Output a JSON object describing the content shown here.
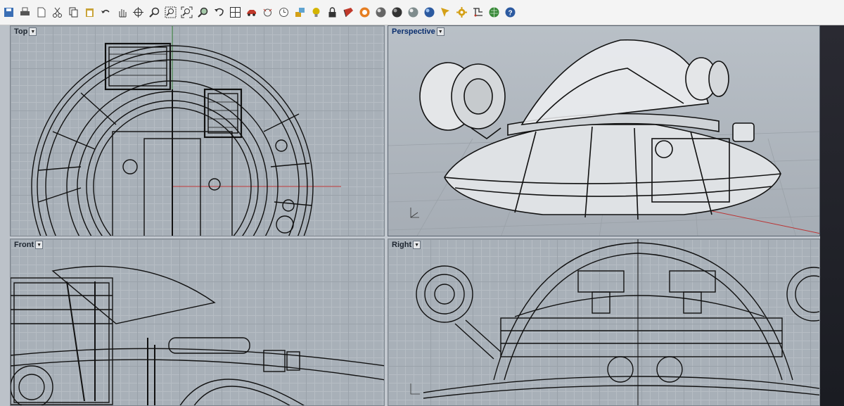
{
  "toolbar": {
    "buttons": [
      {
        "name": "save-file-icon",
        "color": "#3b6fb5"
      },
      {
        "name": "print-icon",
        "color": "#555555"
      },
      {
        "name": "new-file-icon",
        "color": "#555555"
      },
      {
        "name": "cut-icon",
        "color": "#333333"
      },
      {
        "name": "copy-icon",
        "color": "#333333"
      },
      {
        "name": "paste-icon",
        "color": "#c9a43a"
      },
      {
        "name": "undo-icon",
        "color": "#333333"
      },
      {
        "name": "pan-hand-icon",
        "color": "#333333"
      },
      {
        "name": "rotate-view-icon",
        "color": "#333333"
      },
      {
        "name": "zoom-icon",
        "color": "#333333"
      },
      {
        "name": "zoom-window-icon",
        "color": "#333333"
      },
      {
        "name": "zoom-extents-icon",
        "color": "#333333"
      },
      {
        "name": "zoom-selected-icon",
        "color": "#2f8a3a"
      },
      {
        "name": "undo-view-icon",
        "color": "#333333"
      },
      {
        "name": "four-view-icon",
        "color": "#333333"
      },
      {
        "name": "car-icon",
        "color": "#c0392b"
      },
      {
        "name": "camera-target-icon",
        "color": "#555555"
      },
      {
        "name": "clock-icon",
        "color": "#555555"
      },
      {
        "name": "layers-icon",
        "color": "#d4a017"
      },
      {
        "name": "light-bulb-icon",
        "color": "#d4b400"
      },
      {
        "name": "lock-icon",
        "color": "#333333"
      },
      {
        "name": "material-icon",
        "color": "#c0392b"
      },
      {
        "name": "color-wheel-icon",
        "color": "#e67e22"
      },
      {
        "name": "shaded-sphere-icon",
        "color": "#666666"
      },
      {
        "name": "render-sphere-icon",
        "color": "#333333"
      },
      {
        "name": "ghosted-sphere-icon",
        "color": "#7f8c8d"
      },
      {
        "name": "rendered-sphere-icon",
        "color": "#2c5aa0"
      },
      {
        "name": "pen-tool-icon",
        "color": "#d4a017"
      },
      {
        "name": "gear-options-icon",
        "color": "#d4a017"
      },
      {
        "name": "snap-grid-icon",
        "color": "#333333"
      },
      {
        "name": "globe-icon",
        "color": "#3a8a3a"
      },
      {
        "name": "help-icon",
        "color": "#2c5aa0"
      }
    ]
  },
  "viewports": {
    "top": {
      "title": "Top"
    },
    "perspective": {
      "title": "Perspective"
    },
    "front": {
      "title": "Front"
    },
    "right": {
      "title": "Right"
    }
  }
}
